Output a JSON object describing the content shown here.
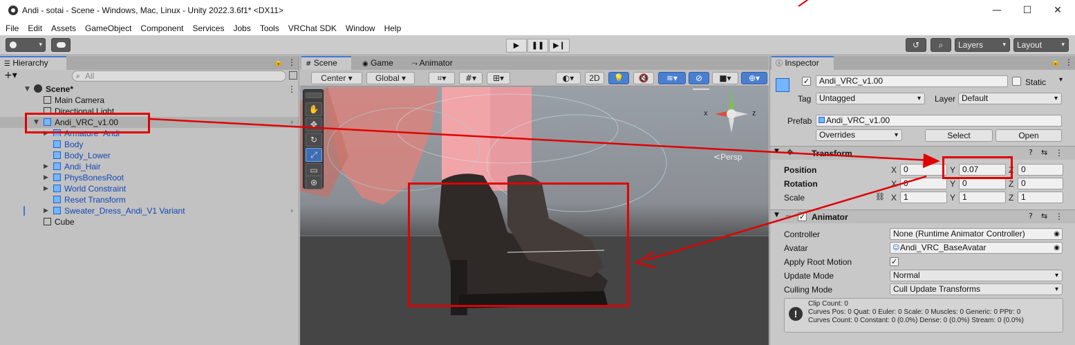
{
  "window": {
    "title": "Andi - sotai - Scene - Windows, Mac, Linux - Unity 2022.3.6f1* <DX11>",
    "minimize": "—",
    "maximize": "☐",
    "close": "✕"
  },
  "menu": [
    "File",
    "Edit",
    "Assets",
    "GameObject",
    "Component",
    "Services",
    "Jobs",
    "Tools",
    "VRChat SDK",
    "Window",
    "Help"
  ],
  "toolbar": {
    "layers_label": "Layers",
    "layout_label": "Layout"
  },
  "hierarchy": {
    "tab": "Hierarchy",
    "search_placeholder": "All",
    "add": "+▾",
    "rows": [
      {
        "label": "Scene*",
        "indent": 0
      },
      {
        "label": "Main Camera"
      },
      {
        "label": "Directional Light"
      },
      {
        "label": "Andi_VRC_v1.00"
      },
      {
        "label": "Armature_Andi"
      },
      {
        "label": "Body"
      },
      {
        "label": "Body_Lower"
      },
      {
        "label": "Andi_Hair"
      },
      {
        "label": "PhysBonesRoot"
      },
      {
        "label": "World Constraint"
      },
      {
        "label": "Reset Transform"
      },
      {
        "label": "Sweater_Dress_Andi_V1 Variant"
      },
      {
        "label": "Cube"
      }
    ]
  },
  "scene": {
    "tabs": [
      "Scene",
      "Game",
      "Animator"
    ],
    "pivot": "Center",
    "space": "Global",
    "mode_2d": "2D",
    "persp": "Persp",
    "gizmo_y": "y",
    "gizmo_x": "x",
    "gizmo_z": "z"
  },
  "inspector": {
    "tab": "Inspector",
    "object_name": "Andi_VRC_v1.00",
    "static_label": "Static",
    "tag_label": "Tag",
    "tag_value": "Untagged",
    "layer_label": "Layer",
    "layer_value": "Default",
    "prefab_label": "Prefab",
    "prefab_value": "Andi_VRC_v1.00",
    "overrides": "Overrides",
    "select": "Select",
    "open": "Open",
    "transform": {
      "title": "Transform",
      "position_label": "Position",
      "rotation_label": "Rotation",
      "scale_label": "Scale",
      "position": {
        "x": "0",
        "y": "0.07",
        "z": "0"
      },
      "rotation": {
        "x": "0",
        "y": "0",
        "z": "0"
      },
      "scale": {
        "x": "1",
        "y": "1",
        "z": "1"
      },
      "axis_x": "X",
      "axis_y": "Y",
      "axis_z": "Z"
    },
    "animator": {
      "title": "Animator",
      "controller_label": "Controller",
      "controller_value": "None (Runtime Animator Controller)",
      "avatar_label": "Avatar",
      "avatar_value": "Andi_VRC_BaseAvatar",
      "root_motion_label": "Apply Root Motion",
      "update_mode_label": "Update Mode",
      "update_mode_value": "Normal",
      "culling_label": "Culling Mode",
      "culling_value": "Cull Update Transforms",
      "info": [
        "Clip Count: 0",
        "Curves Pos: 0 Quat: 0 Euler: 0 Scale: 0 Muscles: 0 Generic: 0 PPtr: 0",
        "Curves Count: 0 Constant: 0 (0.0%) Dense: 0 (0.0%) Stream: 0 (0.0%)"
      ]
    }
  },
  "colors": {
    "annotation": "#e00000",
    "selection_blue": "#3a79d4",
    "prefab_text": "#1247b6"
  }
}
